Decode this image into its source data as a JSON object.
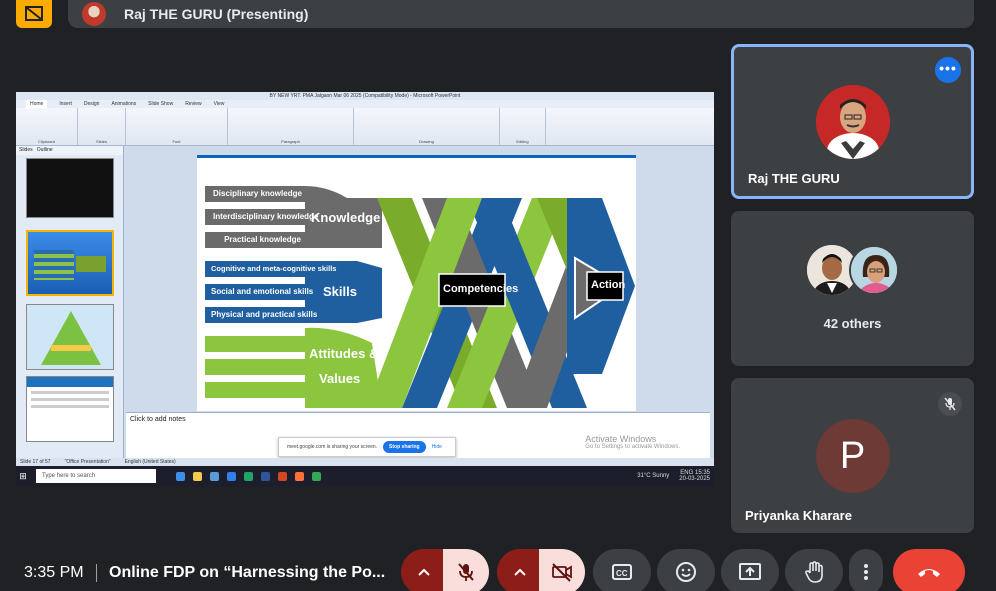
{
  "top_bar": {
    "presenter_label": "Raj THE GURU (Presenting)"
  },
  "shared_screen": {
    "window_title": "BY NEW   YRT. PMA Jalgaon  Mar 06 2025  (Compatibility Mode)  -  Microsoft PowerPoint",
    "ribbon_tabs": [
      "Home",
      "Insert",
      "Design",
      "Animations",
      "Slide Show",
      "Review",
      "View"
    ],
    "ribbon_groups": [
      "Clipboard",
      "Slides",
      "Font",
      "Paragraph",
      "Drawing",
      "Editing"
    ],
    "pane_tabs": [
      "Slides",
      "Outline"
    ],
    "thumb_numbers": [
      "",
      "17",
      "18",
      "19"
    ],
    "slide": {
      "knowledge_items": [
        "Disciplinary knowledge",
        "Interdisciplinary knowledge",
        "Practical knowledge"
      ],
      "skills_items": [
        "Cognitive and meta-cognitive skills",
        "Social and emotional skills",
        "Physical and practical skills"
      ],
      "attitude_items": [
        "",
        ""
      ],
      "knowledge": "Knowledge",
      "skills": "Skills",
      "attitudes": "Attitudes &",
      "values": "Values",
      "competencies": "Competencies",
      "action": "Action"
    },
    "notes_placeholder": "Click to add notes",
    "activate_title": "Activate Windows",
    "activate_sub": "Go to Settings to activate Windows.",
    "share_banner": {
      "text": "meet.google.com is sharing your screen.",
      "stop": "Stop sharing",
      "hide": "Hide"
    },
    "statusbar": [
      "Slide 17 of 57",
      "\"Office Presentation\"",
      "English (United States)"
    ],
    "taskbar": {
      "search_placeholder": "Type here to search",
      "weather": "31°C  Sunny",
      "time": "15:35",
      "date": "20-03-2025",
      "lang": "ENG"
    }
  },
  "participants": [
    {
      "name": "Raj THE GURU",
      "more": "•••"
    },
    {
      "name": "42 others"
    },
    {
      "name": "Priyanka Kharare",
      "initial": "P"
    }
  ],
  "bottom_bar": {
    "time": "3:35 PM",
    "meeting_title": "Online FDP on “Harnessing the Po..."
  }
}
